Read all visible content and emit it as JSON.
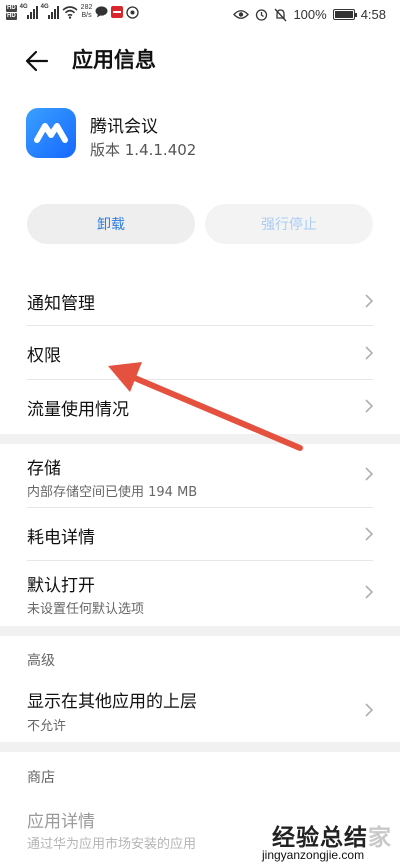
{
  "status_bar": {
    "hd1": "HD",
    "hd2": "HD",
    "sig1_label": "4G",
    "sig2_label": "4G",
    "speed_value": "282",
    "speed_unit": "B/s",
    "battery_text": "100%",
    "battery_level": 1.0,
    "time": "4:58"
  },
  "header": {
    "title": "应用信息"
  },
  "app": {
    "name": "腾讯会议",
    "version": "版本 1.4.1.402"
  },
  "buttons": {
    "uninstall": "卸载",
    "force_stop": "强行停止"
  },
  "items": {
    "notifications": "通知管理",
    "permissions": "权限",
    "data_usage": "流量使用情况",
    "storage": "存储",
    "storage_sub": "内部存储空间已使用 194 MB",
    "battery": "耗电详情",
    "default_open": "默认打开",
    "default_open_sub": "未设置任何默认选项",
    "overlay": "显示在其他应用的上层",
    "overlay_sub": "不允许",
    "app_details": "应用详情",
    "app_details_sub": "通过华为应用市场安装的应用"
  },
  "sections": {
    "advanced": "高级",
    "store": "商店"
  },
  "watermark": {
    "text_main": "经验总结",
    "text_faded": "家",
    "url": "jingyanzongjie.com"
  },
  "colors": {
    "accent": "#2d7fe0",
    "disabled_accent": "#a9cdf5",
    "annotation_arrow": "#e4513f",
    "app_icon": "#1f7bff"
  }
}
